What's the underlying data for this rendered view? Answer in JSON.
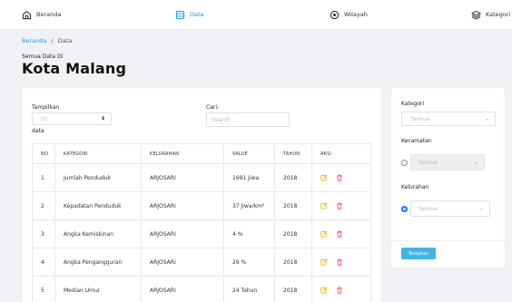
{
  "nav": {
    "items": [
      {
        "label": "Beranda",
        "icon": "home-icon"
      },
      {
        "label": "Data",
        "icon": "database-icon",
        "active": true
      },
      {
        "label": "Wilayah",
        "icon": "map-pin-icon"
      },
      {
        "label": "Kategori",
        "icon": "layers-icon"
      }
    ],
    "accent_color": "#1a9be8"
  },
  "breadcrumb": {
    "home": "Beranda",
    "separator": "/",
    "current": "Data"
  },
  "header": {
    "subtitle": "Semua Data Di",
    "title": "Kota Malang"
  },
  "controls": {
    "show_label": "Tampilkan",
    "show_value": "10",
    "show_suffix": "data",
    "search_label": "Cari:",
    "search_placeholder": "Search"
  },
  "table": {
    "columns": [
      "NO",
      "KATEGORI",
      "KELURAHAN",
      "VALUE",
      "TAHUN",
      "AKSI"
    ],
    "rows": [
      {
        "no": "1",
        "kategori": "Jumlah Penduduk",
        "kelurahan": "ARJOSARI",
        "value": "1691 Jiwa",
        "tahun": "2018"
      },
      {
        "no": "2",
        "kategori": "Kepadatan Penduduk",
        "kelurahan": "ARJOSARI",
        "value": "37 Jiwa/km²",
        "tahun": "2018"
      },
      {
        "no": "3",
        "kategori": "Angka Kemiskinan",
        "kelurahan": "ARJOSARI",
        "value": "4 %",
        "tahun": "2018"
      },
      {
        "no": "4",
        "kategori": "Angka Pengangguran",
        "kelurahan": "ARJOSARI",
        "value": "26 %",
        "tahun": "2018"
      },
      {
        "no": "5",
        "kategori": "Median Umur",
        "kelurahan": "ARJOSARI",
        "value": "24 Tahun",
        "tahun": "2018"
      }
    ],
    "edit_icon_color": "#f0b400",
    "delete_icon_color": "#ee4444"
  },
  "filter": {
    "kategori_label": "Kategori",
    "kategori_value": "Semua",
    "kecamatan_label": "Kecamatan",
    "kecamatan_value": "Semua",
    "kelurahan_label": "Kelurahan",
    "kelurahan_value": "Semua",
    "apply_label": "Terapkan",
    "apply_color": "#41b6e6"
  }
}
